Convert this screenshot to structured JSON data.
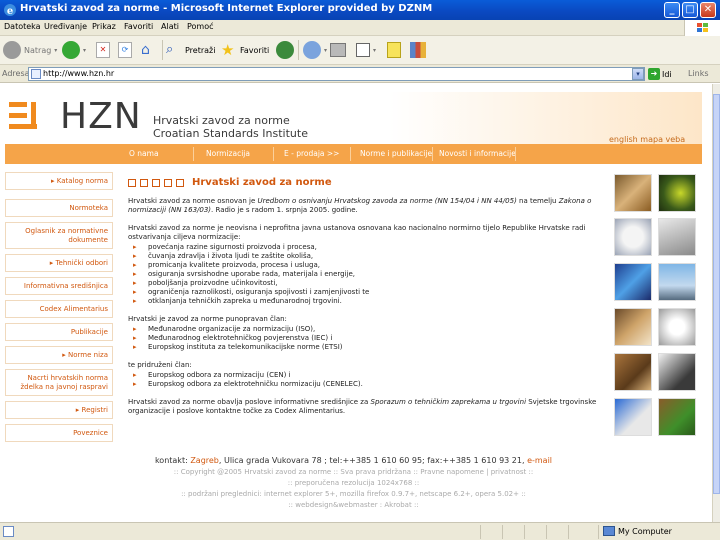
{
  "window": {
    "title": "Hrvatski zavod za norme - Microsoft Internet Explorer provided by DZNM",
    "buttons": {
      "minimize": "_",
      "maximize": "□",
      "close": "✕"
    }
  },
  "menu": [
    "Datoteka",
    "Uređivanje",
    "Prikaz",
    "Favoriti",
    "Alati",
    "Pomoć"
  ],
  "toolbar": {
    "back": "Natrag",
    "search": "Pretraži",
    "favorites": "Favoriti"
  },
  "address": {
    "label": "Adresa",
    "url": "http://www.hzn.hr",
    "go": "Idi",
    "links": "Links"
  },
  "site": {
    "logo": "HZN",
    "name_hr": "Hrvatski zavod za norme",
    "name_en": "Croatian Standards Institute",
    "header_links": "english    mapa veba",
    "nav": [
      "O nama",
      "Normizacija",
      "E - prodaja >>",
      "Norme i publikacije",
      "Novosti i informacije"
    ],
    "sidebar": [
      "▸ Katalog norma",
      "Normoteka",
      "Oglasnik za normativne dokumente",
      "▸ Tehnički odbori",
      "Informativna središnjica",
      "Codex Alimentarius",
      "Publikacije",
      "▸ Norme niza",
      "Nacrti hrvatskih norma ždelka na javnoj raspravi",
      "▸ Registri",
      "Poveznice"
    ],
    "content": {
      "title": "Hrvatski zavod za norme",
      "p1_a": "Hrvatski zavod za norme osnovan je ",
      "p1_i1": "Uredbom o osnivanju Hrvatskog zavoda za norme (NN 154/04 i NN 44/05)",
      "p1_b": " na temelju ",
      "p1_i2": "Zakona o normizaciji (NN 163/03)",
      "p1_c": ". Radio je s radom 1. srpnja 2005. godine.",
      "p2": "Hrvatski zavod za norme je neovisna i neprofitna javna ustanova osnovana kao nacionalno normirno tijelo Republike Hrvatske radi ostvarivanja ciljeva normizacije:",
      "list1": [
        "povećanja razine sigurnosti proizvoda i procesa,",
        "čuvanja zdravlja i života ljudi te zaštite okoliša,",
        "promicanja kvalitete proizvoda, procesa i usluga,",
        "osiguranja svrsishodne uporabe rada, materijala i energije,",
        "poboljšanja proizvodne učinkovitosti,",
        "ograničenja raznolikosti, osiguranja spojivosti i zamjenjivosti te",
        "otklanjanja tehničkih zapreka u međunarodnoj trgovini."
      ],
      "p3": "Hrvatski je zavod za norme punopravan član:",
      "list2": [
        "Međunarodne organizacije za normizaciju (ISO),",
        "Međunarodnog elektrotehničkog povjerenstva (IEC) i",
        "Europskog instituta za telekomunikacijske norme (ETSI)"
      ],
      "p4": "te pridruženi član:",
      "list3": [
        "Europskog odbora za normizaciju (CEN) i",
        "Europskog odbora za elektrotehničku normizaciju (CENELEC)."
      ],
      "p5_a": "Hrvatski zavod za norme obavlja poslove informativne središnjice za ",
      "p5_i": "Sporazum o tehničkim zaprekama u trgovini",
      "p5_b": " Svjetske trgovinske organizacije i poslove kontaktne točke za Codex Alimentarius."
    },
    "footer": {
      "kontakt_label": "kontakt: ",
      "kontakt_city": "Zagreb",
      "kontakt_rest": ", Ulica grada Vukovara 78 ; tel:++385 1 610 60 95; fax:++385 1 610 93 21, ",
      "kontakt_mail": "e-mail",
      "line2": ":: Copyright @2005 Hrvatski zavod za norme :: Sva prava pridržana :: Pravne napomene | privatnost ::",
      "line3": ":: preporučena rezolucija 1024x768 ::",
      "line4": ":: podržani preglednici: internet explorer 5+, mozilla firefox 0.9.7+, netscape 6.2+, opera 5.02+ ::",
      "line5": ":: webdesign&webmaster : Akrobat ::"
    }
  },
  "status": {
    "zone": "My Computer"
  }
}
